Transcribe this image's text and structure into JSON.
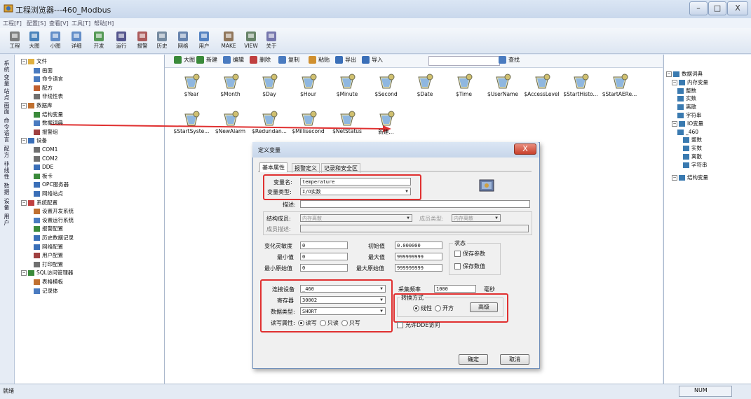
{
  "window": {
    "title": "工程浏览器---460_Modbus",
    "min": "–",
    "max": "□",
    "close": "X"
  },
  "menu": [
    "工程[F]",
    "配置[S]",
    "查看[V]",
    "工具[T]",
    "帮助[H]"
  ],
  "toolbar": [
    "工程",
    "大图",
    "小图",
    "详细",
    "开发",
    "运行",
    "报警",
    "历史",
    "网络",
    "用户",
    "MAKE",
    "VIEW",
    "关于"
  ],
  "vtabs": [
    "系统",
    "变量",
    "站点",
    "画面",
    "命令语言",
    "配方",
    "非线性",
    "数据",
    "设备",
    "用户"
  ],
  "tree": [
    "文件",
    "画面",
    "命令语言",
    "配方",
    "非线性表",
    "数据库",
    "结构变量",
    "数据词典",
    "报警组",
    "设备",
    "COM1",
    "COM2",
    "DDE",
    "板卡",
    "OPC服务器",
    "网络站点",
    "系统配置",
    "设置开发系统",
    "设置运行系统",
    "报警配置",
    "历史数据记录",
    "网络配置",
    "用户配置",
    "打印配置",
    "SQL访问管理器",
    "表格模板",
    "记录体"
  ],
  "content_toolbar": [
    "大图",
    "新建",
    "编辑",
    "删除",
    "复制",
    "粘贴",
    "导出",
    "导入",
    "查找"
  ],
  "variables_row1": [
    "$Year",
    "$Month",
    "$Day",
    "$Hour",
    "$Minute",
    "$Second",
    "$Date",
    "$Time",
    "$UserName",
    "$AccessLevel",
    "$StartHisto...",
    "$StartAERe..."
  ],
  "variables_row2": [
    "$StartSyste...",
    "$NewAlarm",
    "$Redundan...",
    "$Millisecond",
    "$NetStatus",
    "新建..."
  ],
  "rtree": [
    "数据词典",
    "内存变量",
    "整数",
    "实数",
    "离散",
    "字符串",
    "IO变量",
    "_460",
    "整数",
    "实数",
    "离散",
    "字符串",
    "结构变量"
  ],
  "dialog": {
    "title": "定义变量",
    "close": "X",
    "tabs": [
      "基本属性",
      "报警定义",
      "记录和安全区"
    ],
    "var_name_label": "变量名:",
    "var_name": "temperature",
    "var_type_label": "变量类型:",
    "var_type": "I/O实数",
    "desc_label": "描述:",
    "desc": "",
    "struct_label": "结构成员:",
    "struct_value": "内存离散",
    "member_type_label": "成员类型:",
    "member_type": "内存离散",
    "member_desc_label": "成员描述:",
    "sens_label": "变化灵敏度",
    "sens": "0",
    "init_label": "初始值",
    "init": "0.000000",
    "min_label": "最小值",
    "min": "0",
    "max_label": "最大值",
    "max": "999999999",
    "rawmin_label": "最小原始值",
    "rawmin": "0",
    "rawmax_label": "最大原始值",
    "rawmax": "999999999",
    "state_label": "状态",
    "save_param": "保存参数",
    "save_value": "保存数值",
    "device_label": "连接设备",
    "device": "_460",
    "freq_label": "采集频率",
    "freq": "1000",
    "freq_unit": "毫秒",
    "reg_label": "寄存器",
    "reg": "30002",
    "dtype_label": "数据类型:",
    "dtype": "SHORT",
    "rw_label": "读写属性:",
    "rw_options": [
      "读写",
      "只读",
      "只写"
    ],
    "conv_label": "转换方式",
    "conv_options": [
      "线性",
      "开方"
    ],
    "advanced": "高级",
    "dde_label": "允许DDE访问",
    "ok": "确定",
    "cancel": "取消"
  },
  "status": {
    "left": "就绪",
    "right": "NUM"
  },
  "colors": {
    "accent": "#e03030",
    "titlebar": "#c9d8ec",
    "icon_blue": "#3a6fb8"
  }
}
